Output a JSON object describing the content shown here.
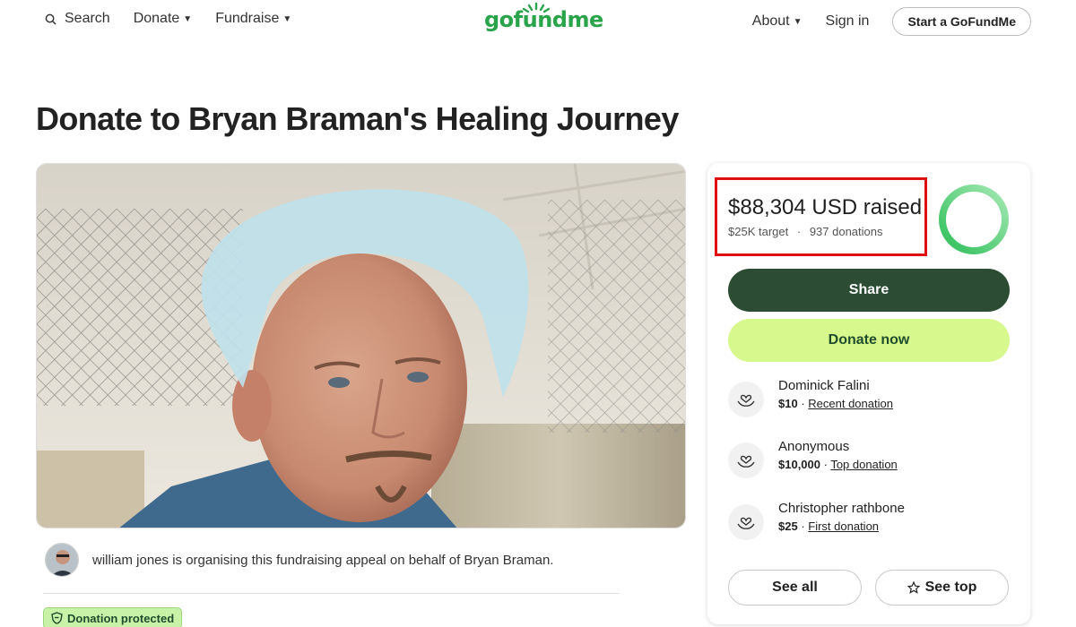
{
  "header": {
    "search_label": "Search",
    "donate_label": "Donate",
    "fundraise_label": "Fundraise",
    "logo_text": "gofundme",
    "about_label": "About",
    "signin_label": "Sign in",
    "start_label": "Start a GoFundMe"
  },
  "page": {
    "title": "Donate to Bryan Braman's Healing Journey"
  },
  "organizer": {
    "text": "william jones is organising this fundraising appeal on behalf of Bryan Braman."
  },
  "badge": {
    "label": "Donation protected"
  },
  "summary": {
    "raised": "$88,304 USD raised",
    "target": "$25K target",
    "separator": "·",
    "donations": "937 donations",
    "progress_fraction": 1.0
  },
  "actions": {
    "share_label": "Share",
    "donate_now_label": "Donate now",
    "see_all_label": "See all",
    "see_top_label": "See top"
  },
  "donors": [
    {
      "name": "Dominick Falini",
      "amount": "$10",
      "sep": " · ",
      "tag": "Recent donation"
    },
    {
      "name": "Anonymous",
      "amount": "$10,000",
      "sep": " · ",
      "tag": "Top donation"
    },
    {
      "name": "Christopher rathbone",
      "amount": "$25",
      "sep": " · ",
      "tag": "First donation"
    }
  ],
  "colors": {
    "brand_green": "#2aa44a",
    "share_bg": "#2c4d33",
    "donate_bg": "#d6f88c",
    "highlight_red": "#e01010"
  }
}
